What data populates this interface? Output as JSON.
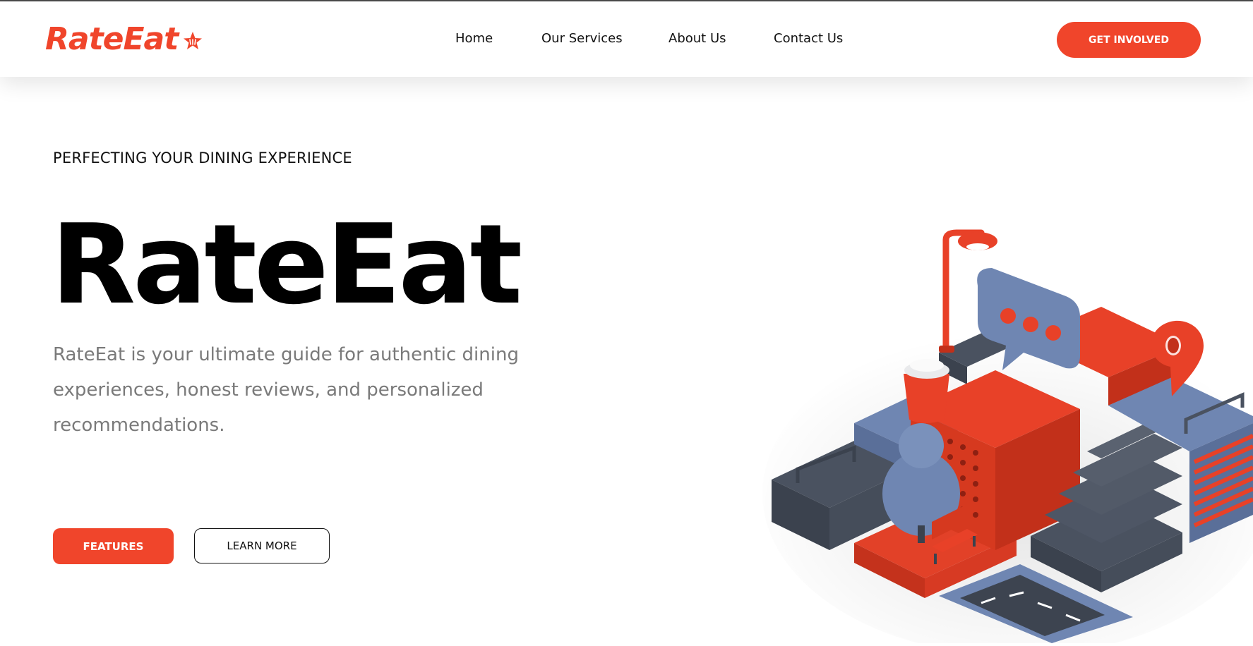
{
  "brand": {
    "name": "RateEat",
    "accent_color": "#f0452b",
    "logo_icon": "star-logo-icon"
  },
  "nav": {
    "items": [
      "Home",
      "Our Services",
      "About Us",
      "Contact Us"
    ],
    "cta_label": "GET INVOLVED"
  },
  "hero": {
    "eyebrow": "PERFECTING YOUR DINING EXPERIENCE",
    "title": "RateEat",
    "description": "RateEat is your ultimate guide for authentic dining experiences, honest reviews, and personalized recommendations.",
    "primary_button": "FEATURES",
    "secondary_button": "LEARN MORE"
  },
  "illustration": {
    "name": "isometric-city-block-illustration",
    "colors": {
      "red": "#e84128",
      "blue": "#6d86b3",
      "slate": "#3e4754"
    }
  }
}
